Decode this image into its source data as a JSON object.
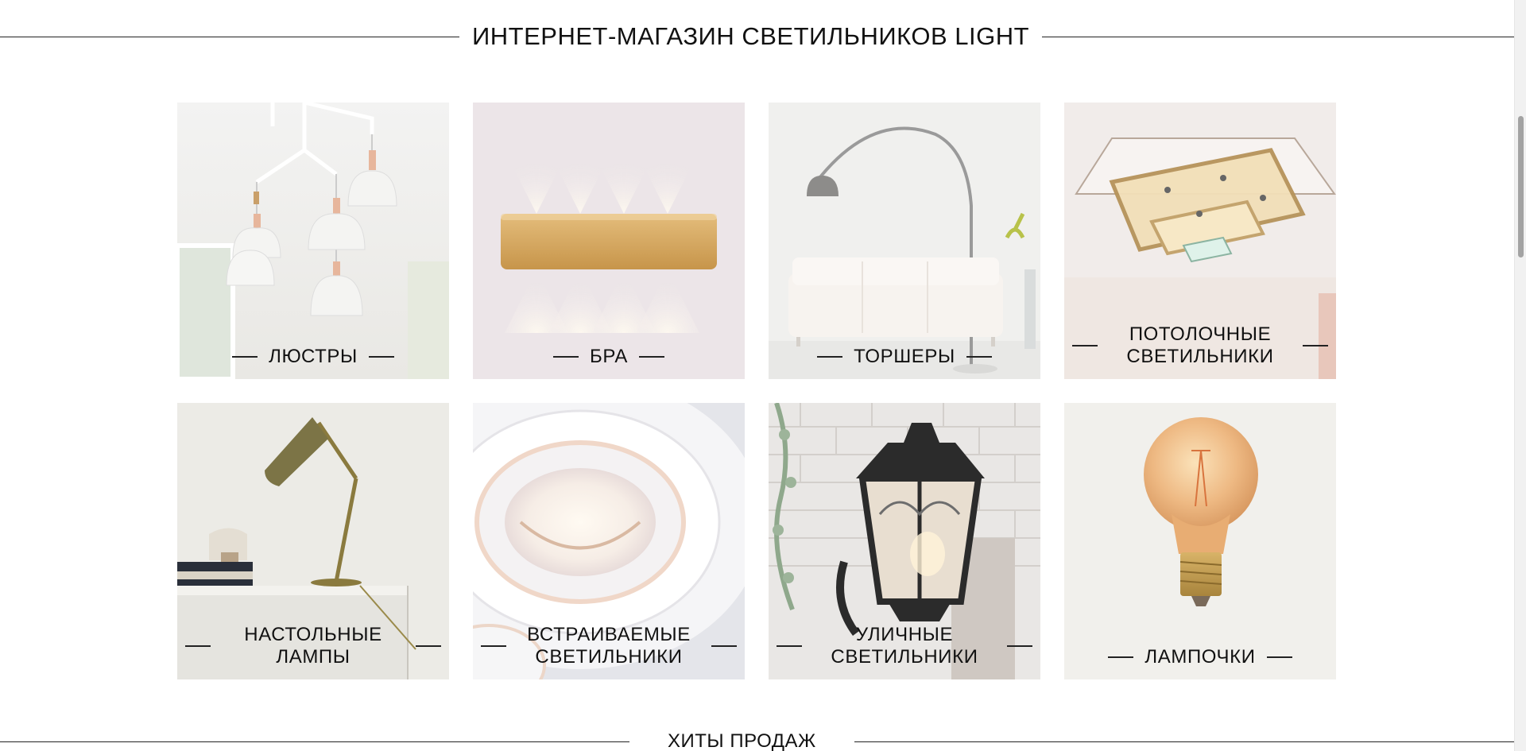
{
  "header": {
    "title": "ИНТЕРНЕТ-МАГАЗИН СВЕТИЛЬНИКОВ LIGHT"
  },
  "categories": [
    {
      "label": "ЛЮСТРЫ",
      "icon": "chandelier-image"
    },
    {
      "label": "БРА",
      "icon": "wall-sconce-image"
    },
    {
      "label": "ТОРШЕРЫ",
      "icon": "floor-lamp-image"
    },
    {
      "label": "ПОТОЛОЧНЫЕ СВЕТИЛЬНИКИ",
      "icon": "ceiling-light-image"
    },
    {
      "label": "НАСТОЛЬНЫЕ ЛАМПЫ",
      "icon": "desk-lamp-image"
    },
    {
      "label": "ВСТРАИВАЕМЫЕ СВЕТИЛЬНИКИ",
      "icon": "recessed-light-image"
    },
    {
      "label": "УЛИЧНЫЕ СВЕТИЛЬНИКИ",
      "icon": "outdoor-lantern-image"
    },
    {
      "label": "ЛАМПОЧКИ",
      "icon": "light-bulb-image"
    }
  ],
  "next_section": {
    "title": "ХИТЫ ПРОДАЖ"
  }
}
